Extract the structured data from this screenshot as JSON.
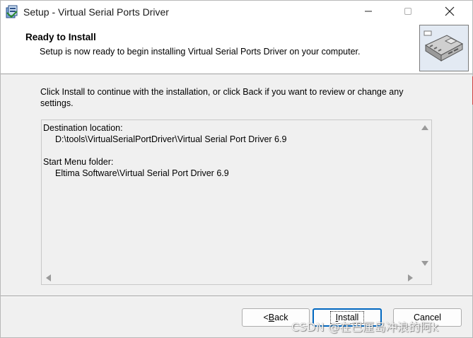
{
  "window": {
    "title": "Setup - Virtual Serial Ports Driver"
  },
  "header": {
    "title": "Ready to Install",
    "subtitle": "Setup is now ready to begin installing Virtual Serial Ports Driver on your computer."
  },
  "body": {
    "intro": "Click Install to continue with the installation, or click Back if you want to review or change any settings."
  },
  "memo": {
    "destination_label": "Destination location:",
    "destination_value": "D:\\tools\\VirtualSerialPortDriver\\Virtual Serial Port Driver 6.9",
    "startmenu_label": "Start Menu folder:",
    "startmenu_value": "Eltima Software\\Virtual Serial Port Driver 6.9"
  },
  "buttons": {
    "back_prefix": "< ",
    "back_accel": "B",
    "back_rest": "ack",
    "install_accel": "I",
    "install_rest": "nstall",
    "cancel": "Cancel"
  },
  "watermark": "CSDN @在巴厘岛冲浪的阿k",
  "icons": {
    "app": "setup-icon",
    "minimize": "minimize-icon",
    "maximize": "maximize-icon",
    "close": "close-icon",
    "header_image": "driver-chip-icon"
  },
  "colors": {
    "accent": "#0067c0",
    "window_bg": "#f0f0f0",
    "header_bg": "#ffffff"
  }
}
